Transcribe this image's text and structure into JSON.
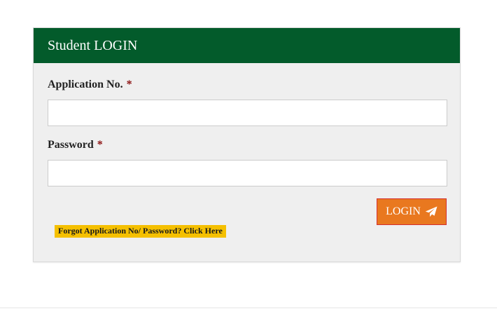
{
  "login_panel": {
    "title": "Student LOGIN",
    "application_no_label": "Application No.",
    "application_no_required": "*",
    "application_no_value": "",
    "password_label": "Password",
    "password_required": "*",
    "password_value": "",
    "login_button_label": "LOGIN",
    "login_button_icon": "paper-plane-icon",
    "forgot_link_text": "Forgot Application No/ Password? Click Here"
  },
  "colors": {
    "header_bg": "#035b2b",
    "panel_bg": "#efefef",
    "button_bg": "#e9781f",
    "link_bg": "#f5c000",
    "required_color": "#8b1010"
  }
}
